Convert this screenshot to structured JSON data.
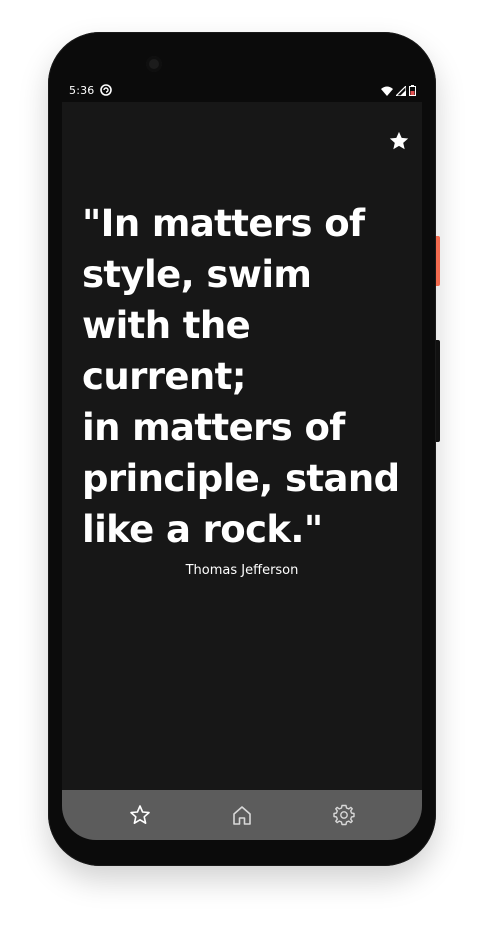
{
  "status_bar": {
    "time": "5:36",
    "icons": [
      "sync-icon",
      "wifi-icon",
      "signal-icon",
      "battery-icon"
    ]
  },
  "quote": {
    "text": "\"In matters of style, swim with the current;\nin matters of principle, stand like a rock.\"",
    "author": "Thomas Jefferson"
  },
  "actions": {
    "favorite_icon": "star-filled-icon"
  },
  "bottom_nav": {
    "items": [
      {
        "icon": "star-outline-icon"
      },
      {
        "icon": "home-icon"
      },
      {
        "icon": "settings-gear-icon"
      }
    ]
  },
  "colors": {
    "screen_bg": "#171717",
    "nav_bg": "#5c5c5c",
    "text": "#ffffff",
    "accent_side_button": "#f26b4f"
  }
}
